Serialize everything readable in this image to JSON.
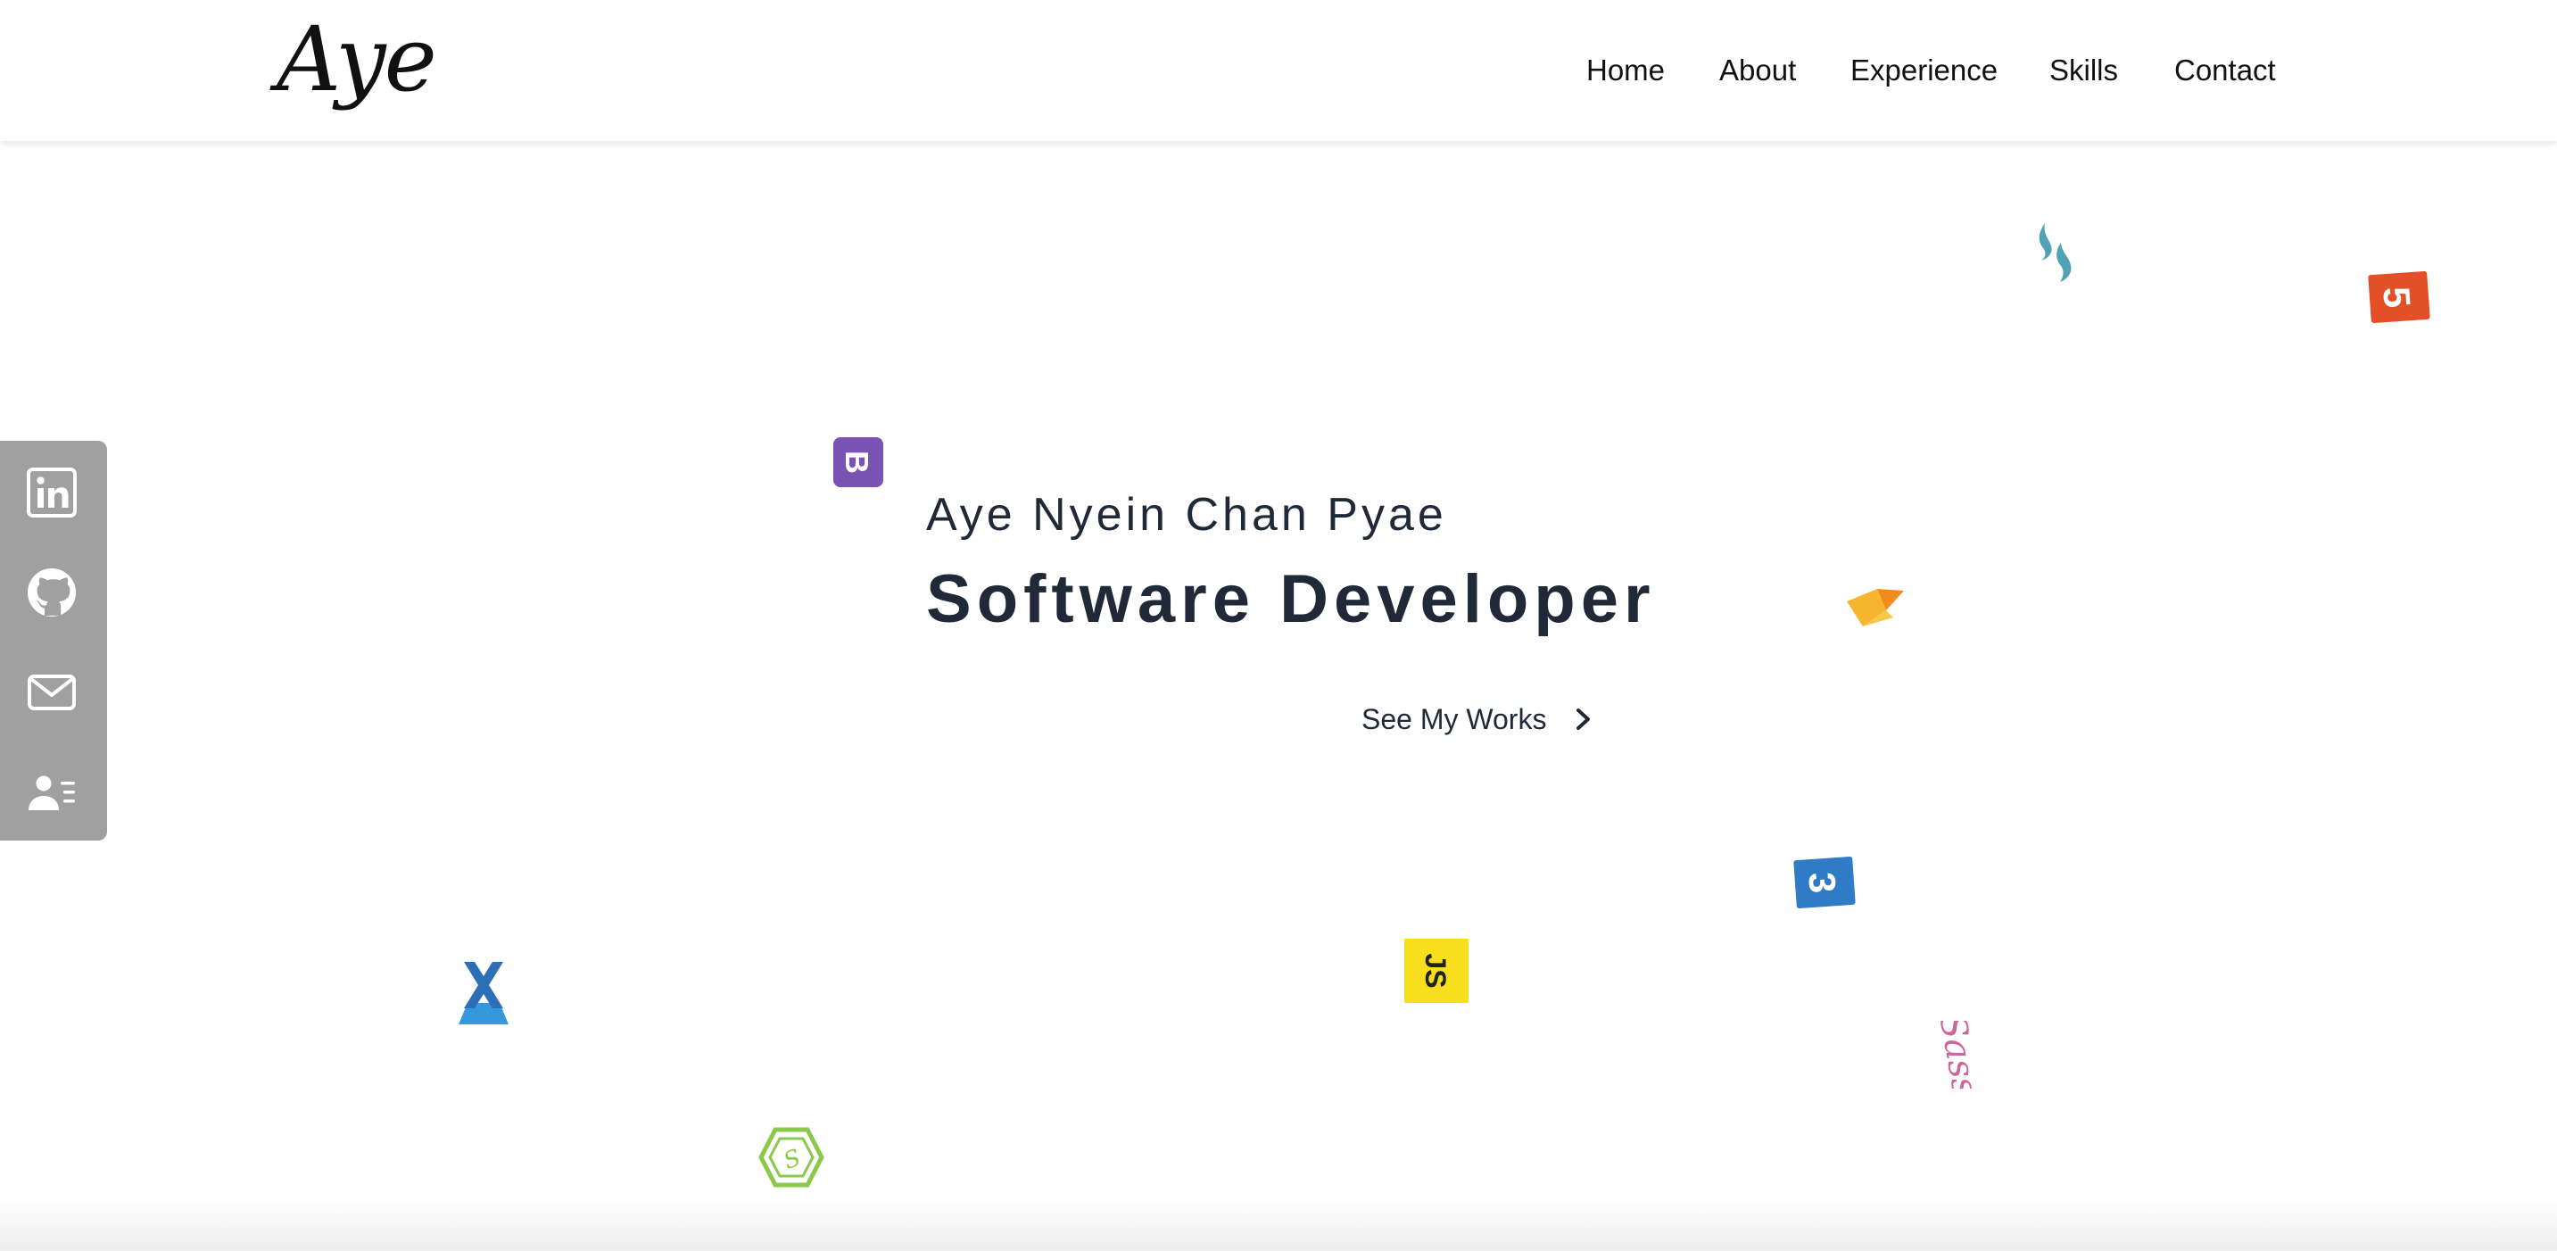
{
  "header": {
    "logo_text": "Aye",
    "nav": {
      "home": "Home",
      "about": "About",
      "experience": "Experience",
      "skills": "Skills",
      "contact": "Contact"
    }
  },
  "social": {
    "background_color": "#a0a0a0",
    "icon_color": "#ffffff",
    "items": [
      "linkedin-icon",
      "github-icon",
      "mail-icon",
      "contact-card-icon"
    ]
  },
  "hero": {
    "name": "Aye Nyein Chan Pyae",
    "role": "Software Developer",
    "cta_label": "See My Works",
    "cta_icon": "chevron-right-icon"
  },
  "floating_icons": [
    {
      "name": "tailwind-icon",
      "color": "#4fa3b5"
    },
    {
      "name": "html5-icon",
      "color": "#e34f26",
      "label": "5"
    },
    {
      "name": "bootstrap-icon",
      "color": "#7952b3",
      "label": "B"
    },
    {
      "name": "firebase-icon",
      "color": "#f6a623"
    },
    {
      "name": "css3-icon",
      "color": "#2f7bc6",
      "label": "3"
    },
    {
      "name": "javascript-icon",
      "color": "#f7df1e",
      "label": "JS"
    },
    {
      "name": "sass-icon",
      "color": "#cd6799",
      "label": "Sass"
    },
    {
      "name": "xamarin-icon",
      "color": "#3498db"
    },
    {
      "name": "nodejs-icon",
      "color": "#8cc84b",
      "label": "S"
    }
  ]
}
